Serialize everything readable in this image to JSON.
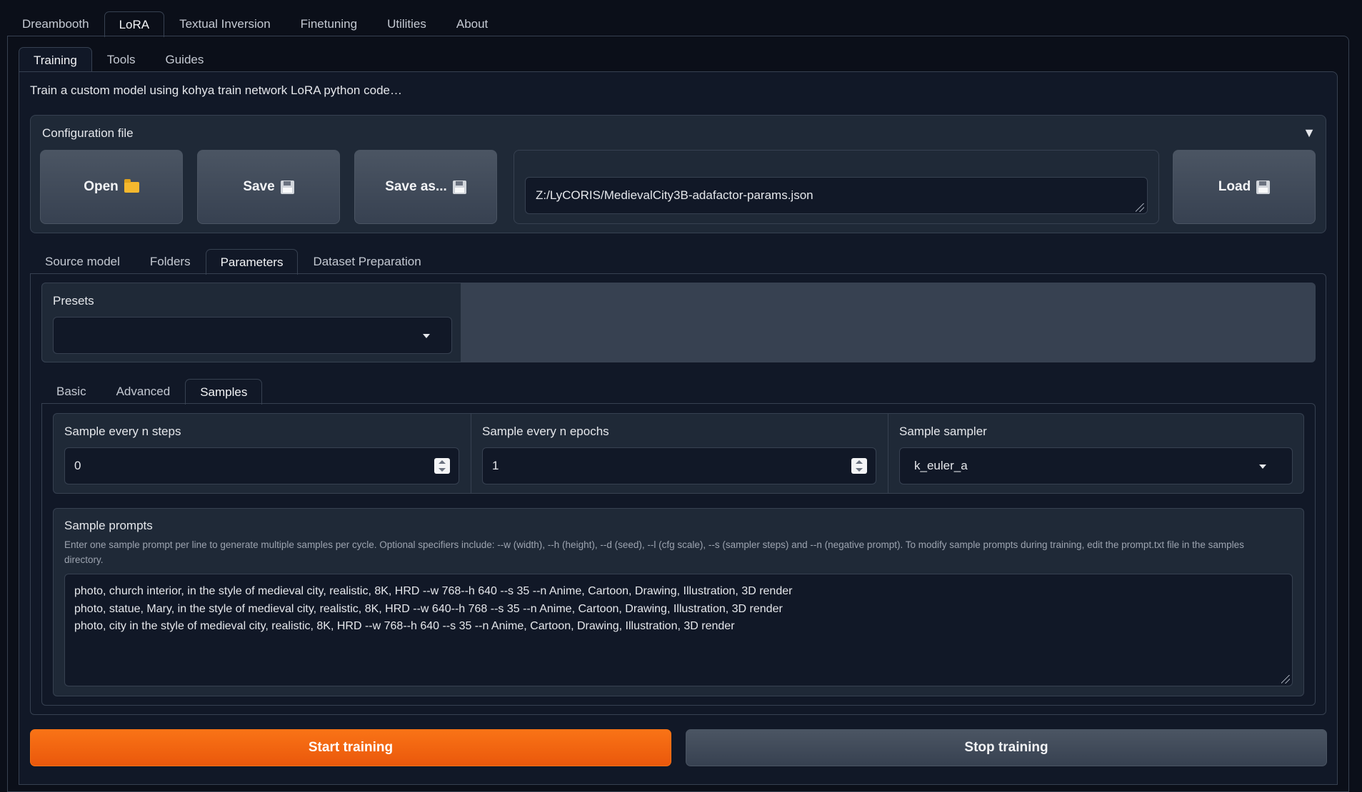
{
  "top_tabs": [
    "Dreambooth",
    "LoRA",
    "Textual Inversion",
    "Finetuning",
    "Utilities",
    "About"
  ],
  "sub_tabs": [
    "Training",
    "Tools",
    "Guides"
  ],
  "intro_text": "Train a custom model using kohya train network LoRA python code…",
  "config": {
    "title": "Configuration file",
    "toggle": "▼",
    "open_label": "Open",
    "save_label": "Save",
    "save_as_label": "Save as...",
    "load_label": "Load",
    "file_path": "Z:/LyCORIS/MedievalCity3B-adafactor-params.json"
  },
  "model_tabs": [
    "Source model",
    "Folders",
    "Parameters",
    "Dataset Preparation"
  ],
  "presets": {
    "label": "Presets",
    "value": ""
  },
  "param_tabs": [
    "Basic",
    "Advanced",
    "Samples"
  ],
  "samples": {
    "every_n_steps_label": "Sample every n steps",
    "every_n_steps_value": "0",
    "every_n_epochs_label": "Sample every n epochs",
    "every_n_epochs_value": "1",
    "sampler_label": "Sample sampler",
    "sampler_value": "k_euler_a"
  },
  "prompts": {
    "label": "Sample prompts",
    "info": "Enter one sample prompt per line to generate multiple samples per cycle. Optional specifiers include: --w (width), --h (height), --d (seed), --l (cfg scale), --s (sampler steps) and --n (negative prompt). To modify sample prompts during training, edit the prompt.txt file in the samples directory.",
    "lines": [
      "photo, church interior, in the style of medieval city, realistic, 8K, HRD --w 768--h 640 --s 35  --n Anime, Cartoon, Drawing, Illustration, 3D render",
      "photo, statue, Mary, in the style of medieval city, realistic, 8K, HRD --w 640--h 768 --s 35  --n Anime, Cartoon, Drawing, Illustration, 3D render",
      "photo, city in the style of medieval city, realistic, 8K, HRD --w 768--h 640 --s 35  --n Anime, Cartoon, Drawing, Illustration, 3D render"
    ]
  },
  "actions": {
    "start_label": "Start training",
    "stop_label": "Stop training"
  },
  "colors": {
    "background": "#0b0f19",
    "panel": "#1f2937",
    "accent": "#f97316",
    "border": "#374151"
  }
}
